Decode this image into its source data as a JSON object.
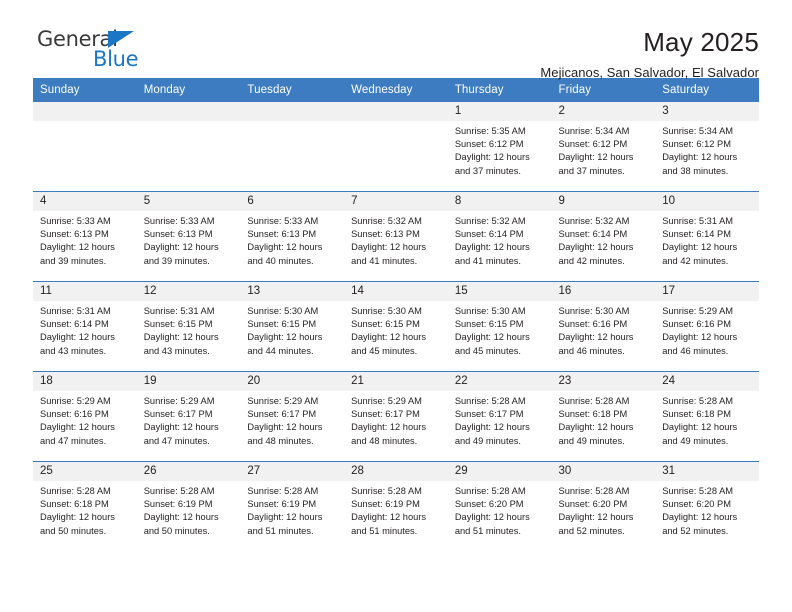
{
  "brand": {
    "name_part1": "General",
    "name_part2": "Blue",
    "triangle_color": "#1b76c5"
  },
  "header": {
    "month_title": "May 2025",
    "location": "Mejicanos, San Salvador, El Salvador",
    "header_bg": "#3d7cc0",
    "daynum_bg": "#f1f1f1"
  },
  "calendar": {
    "weekday_headers": [
      "Sunday",
      "Monday",
      "Tuesday",
      "Wednesday",
      "Thursday",
      "Friday",
      "Saturday"
    ],
    "weeks": [
      [
        {
          "day": "",
          "empty": true
        },
        {
          "day": "",
          "empty": true
        },
        {
          "day": "",
          "empty": true
        },
        {
          "day": "",
          "empty": true
        },
        {
          "day": "1",
          "sunrise": "Sunrise: 5:35 AM",
          "sunset": "Sunset: 6:12 PM",
          "daylight1": "Daylight: 12 hours",
          "daylight2": "and 37 minutes."
        },
        {
          "day": "2",
          "sunrise": "Sunrise: 5:34 AM",
          "sunset": "Sunset: 6:12 PM",
          "daylight1": "Daylight: 12 hours",
          "daylight2": "and 37 minutes."
        },
        {
          "day": "3",
          "sunrise": "Sunrise: 5:34 AM",
          "sunset": "Sunset: 6:12 PM",
          "daylight1": "Daylight: 12 hours",
          "daylight2": "and 38 minutes."
        }
      ],
      [
        {
          "day": "4",
          "sunrise": "Sunrise: 5:33 AM",
          "sunset": "Sunset: 6:13 PM",
          "daylight1": "Daylight: 12 hours",
          "daylight2": "and 39 minutes."
        },
        {
          "day": "5",
          "sunrise": "Sunrise: 5:33 AM",
          "sunset": "Sunset: 6:13 PM",
          "daylight1": "Daylight: 12 hours",
          "daylight2": "and 39 minutes."
        },
        {
          "day": "6",
          "sunrise": "Sunrise: 5:33 AM",
          "sunset": "Sunset: 6:13 PM",
          "daylight1": "Daylight: 12 hours",
          "daylight2": "and 40 minutes."
        },
        {
          "day": "7",
          "sunrise": "Sunrise: 5:32 AM",
          "sunset": "Sunset: 6:13 PM",
          "daylight1": "Daylight: 12 hours",
          "daylight2": "and 41 minutes."
        },
        {
          "day": "8",
          "sunrise": "Sunrise: 5:32 AM",
          "sunset": "Sunset: 6:14 PM",
          "daylight1": "Daylight: 12 hours",
          "daylight2": "and 41 minutes."
        },
        {
          "day": "9",
          "sunrise": "Sunrise: 5:32 AM",
          "sunset": "Sunset: 6:14 PM",
          "daylight1": "Daylight: 12 hours",
          "daylight2": "and 42 minutes."
        },
        {
          "day": "10",
          "sunrise": "Sunrise: 5:31 AM",
          "sunset": "Sunset: 6:14 PM",
          "daylight1": "Daylight: 12 hours",
          "daylight2": "and 42 minutes."
        }
      ],
      [
        {
          "day": "11",
          "sunrise": "Sunrise: 5:31 AM",
          "sunset": "Sunset: 6:14 PM",
          "daylight1": "Daylight: 12 hours",
          "daylight2": "and 43 minutes."
        },
        {
          "day": "12",
          "sunrise": "Sunrise: 5:31 AM",
          "sunset": "Sunset: 6:15 PM",
          "daylight1": "Daylight: 12 hours",
          "daylight2": "and 43 minutes."
        },
        {
          "day": "13",
          "sunrise": "Sunrise: 5:30 AM",
          "sunset": "Sunset: 6:15 PM",
          "daylight1": "Daylight: 12 hours",
          "daylight2": "and 44 minutes."
        },
        {
          "day": "14",
          "sunrise": "Sunrise: 5:30 AM",
          "sunset": "Sunset: 6:15 PM",
          "daylight1": "Daylight: 12 hours",
          "daylight2": "and 45 minutes."
        },
        {
          "day": "15",
          "sunrise": "Sunrise: 5:30 AM",
          "sunset": "Sunset: 6:15 PM",
          "daylight1": "Daylight: 12 hours",
          "daylight2": "and 45 minutes."
        },
        {
          "day": "16",
          "sunrise": "Sunrise: 5:30 AM",
          "sunset": "Sunset: 6:16 PM",
          "daylight1": "Daylight: 12 hours",
          "daylight2": "and 46 minutes."
        },
        {
          "day": "17",
          "sunrise": "Sunrise: 5:29 AM",
          "sunset": "Sunset: 6:16 PM",
          "daylight1": "Daylight: 12 hours",
          "daylight2": "and 46 minutes."
        }
      ],
      [
        {
          "day": "18",
          "sunrise": "Sunrise: 5:29 AM",
          "sunset": "Sunset: 6:16 PM",
          "daylight1": "Daylight: 12 hours",
          "daylight2": "and 47 minutes."
        },
        {
          "day": "19",
          "sunrise": "Sunrise: 5:29 AM",
          "sunset": "Sunset: 6:17 PM",
          "daylight1": "Daylight: 12 hours",
          "daylight2": "and 47 minutes."
        },
        {
          "day": "20",
          "sunrise": "Sunrise: 5:29 AM",
          "sunset": "Sunset: 6:17 PM",
          "daylight1": "Daylight: 12 hours",
          "daylight2": "and 48 minutes."
        },
        {
          "day": "21",
          "sunrise": "Sunrise: 5:29 AM",
          "sunset": "Sunset: 6:17 PM",
          "daylight1": "Daylight: 12 hours",
          "daylight2": "and 48 minutes."
        },
        {
          "day": "22",
          "sunrise": "Sunrise: 5:28 AM",
          "sunset": "Sunset: 6:17 PM",
          "daylight1": "Daylight: 12 hours",
          "daylight2": "and 49 minutes."
        },
        {
          "day": "23",
          "sunrise": "Sunrise: 5:28 AM",
          "sunset": "Sunset: 6:18 PM",
          "daylight1": "Daylight: 12 hours",
          "daylight2": "and 49 minutes."
        },
        {
          "day": "24",
          "sunrise": "Sunrise: 5:28 AM",
          "sunset": "Sunset: 6:18 PM",
          "daylight1": "Daylight: 12 hours",
          "daylight2": "and 49 minutes."
        }
      ],
      [
        {
          "day": "25",
          "sunrise": "Sunrise: 5:28 AM",
          "sunset": "Sunset: 6:18 PM",
          "daylight1": "Daylight: 12 hours",
          "daylight2": "and 50 minutes."
        },
        {
          "day": "26",
          "sunrise": "Sunrise: 5:28 AM",
          "sunset": "Sunset: 6:19 PM",
          "daylight1": "Daylight: 12 hours",
          "daylight2": "and 50 minutes."
        },
        {
          "day": "27",
          "sunrise": "Sunrise: 5:28 AM",
          "sunset": "Sunset: 6:19 PM",
          "daylight1": "Daylight: 12 hours",
          "daylight2": "and 51 minutes."
        },
        {
          "day": "28",
          "sunrise": "Sunrise: 5:28 AM",
          "sunset": "Sunset: 6:19 PM",
          "daylight1": "Daylight: 12 hours",
          "daylight2": "and 51 minutes."
        },
        {
          "day": "29",
          "sunrise": "Sunrise: 5:28 AM",
          "sunset": "Sunset: 6:20 PM",
          "daylight1": "Daylight: 12 hours",
          "daylight2": "and 51 minutes."
        },
        {
          "day": "30",
          "sunrise": "Sunrise: 5:28 AM",
          "sunset": "Sunset: 6:20 PM",
          "daylight1": "Daylight: 12 hours",
          "daylight2": "and 52 minutes."
        },
        {
          "day": "31",
          "sunrise": "Sunrise: 5:28 AM",
          "sunset": "Sunset: 6:20 PM",
          "daylight1": "Daylight: 12 hours",
          "daylight2": "and 52 minutes."
        }
      ]
    ]
  }
}
